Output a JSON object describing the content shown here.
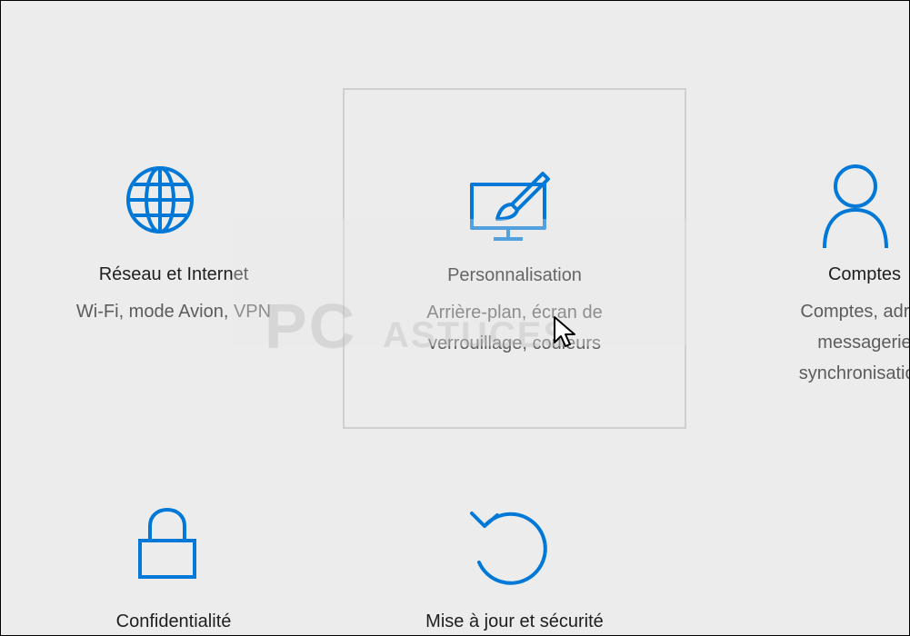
{
  "tiles": [
    {
      "key": "network",
      "title": "Réseau et Internet",
      "desc": [
        "Wi-Fi, mode Avion, VPN"
      ],
      "icon": "globe-icon"
    },
    {
      "key": "personalization",
      "title": "Personnalisation",
      "desc": [
        "Arrière-plan, écran de",
        "verrouillage, couleurs"
      ],
      "icon": "paint-screen-icon"
    },
    {
      "key": "accounts",
      "title": "Comptes",
      "desc": [
        "Comptes, adres",
        "messagerie",
        "synchronisation,"
      ],
      "icon": "person-icon"
    },
    {
      "key": "privacy",
      "title": "Confidentialité",
      "desc": [],
      "icon": "lock-icon"
    },
    {
      "key": "update",
      "title": "Mise à jour et sécurité",
      "desc": [],
      "icon": "refresh-icon"
    }
  ],
  "watermark": {
    "text": "PC ASTUCES"
  },
  "colors": {
    "accent": "#0078d7",
    "background": "#ececec",
    "hover_border": "#cfcfcf"
  }
}
